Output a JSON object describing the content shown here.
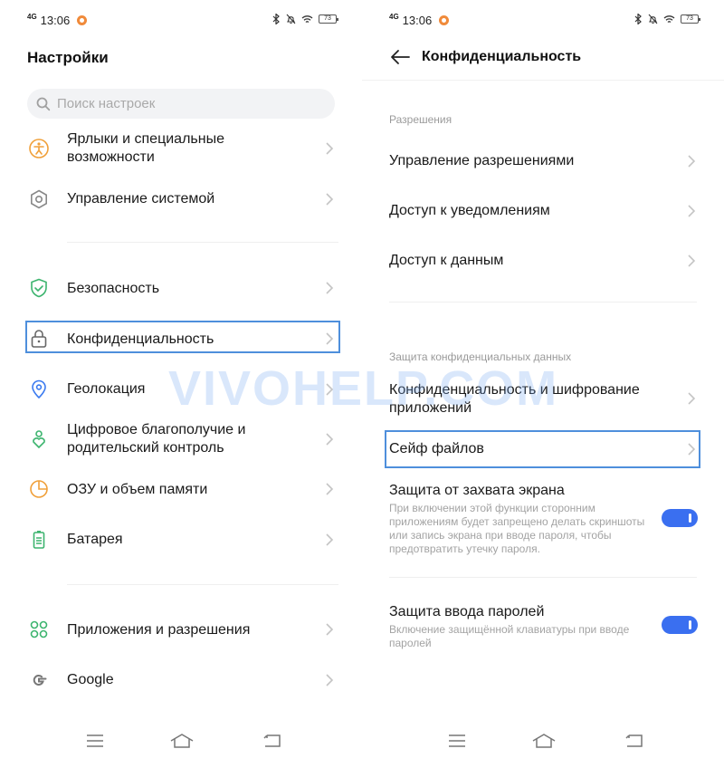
{
  "left": {
    "status": {
      "signal": "4G",
      "time": "13:06",
      "battery": "73"
    },
    "title": "Настройки",
    "search": {
      "placeholder": "Поиск настроек"
    },
    "items": [
      {
        "label": "Ярлыки и специальные возможности",
        "icon": "accessibility-icon",
        "color": "#f0a03a"
      },
      {
        "label": "Управление системой",
        "icon": "hexagon-gear-icon",
        "color": "#888888"
      },
      {
        "label": "Безопасность",
        "icon": "shield-check-icon",
        "color": "#3cb46e"
      },
      {
        "label": "Конфиденциальность",
        "icon": "lock-icon",
        "color": "#666666"
      },
      {
        "label": "Геолокация",
        "icon": "location-pin-icon",
        "color": "#3a7af0"
      },
      {
        "label": "Цифровое благополучие и родительский контроль",
        "icon": "wellbeing-icon",
        "color": "#3cb46e"
      },
      {
        "label": "ОЗУ и объем памяти",
        "icon": "pie-chart-icon",
        "color": "#f0a03a"
      },
      {
        "label": "Батарея",
        "icon": "battery-icon",
        "color": "#3cb46e"
      },
      {
        "label": "Приложения и разрешения",
        "icon": "apps-grid-icon",
        "color": "#3cb46e"
      },
      {
        "label": "Google",
        "icon": "google-icon",
        "color": "#777777"
      }
    ]
  },
  "right": {
    "status": {
      "signal": "4G",
      "time": "13:06",
      "battery": "73"
    },
    "title": "Конфиденциальность",
    "section1": "Разрешения",
    "items1": [
      {
        "label": "Управление разрешениями"
      },
      {
        "label": "Доступ к уведомлениям"
      },
      {
        "label": "Доступ к данным"
      }
    ],
    "section2": "Защита конфиденциальных данных",
    "items2": [
      {
        "label": "Конфиденциальность и шифрование приложений"
      },
      {
        "label": "Сейф файлов"
      }
    ],
    "toggles": [
      {
        "label": "Защита от захвата экрана",
        "desc": "При включении этой функции сторонним приложениям будет запрещено делать скриншоты или запись экрана при вводе пароля, чтобы предотвратить утечку пароля.",
        "on": true
      },
      {
        "label": "Защита ввода паролей",
        "desc": "Включение защищённой клавиатуры при вводе паролей",
        "on": true
      }
    ]
  },
  "watermark": "VIVOHELP.COM",
  "colors": {
    "highlight": "#4e8fdc",
    "toggle_on": "#3a6ff0"
  }
}
